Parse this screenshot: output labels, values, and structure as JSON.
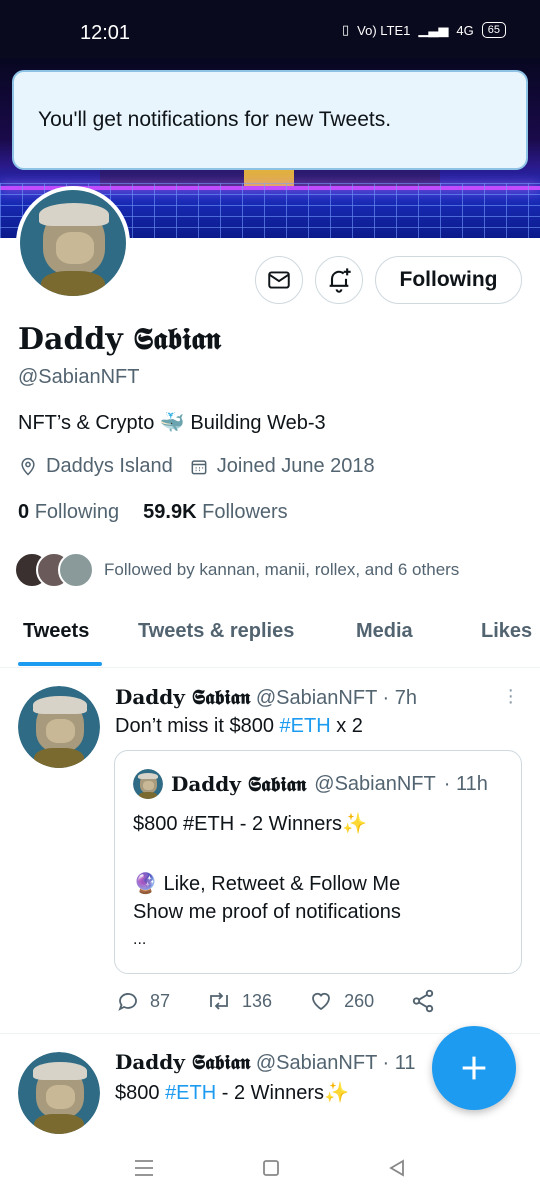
{
  "status_bar": {
    "time": "12:01",
    "network": "Vo) LTE1",
    "signal": "4G",
    "battery": "65"
  },
  "toast": {
    "message": "You'll get notifications for new Tweets."
  },
  "profile": {
    "display_name": "Daddy 𝕾𝖆𝖇𝖎𝖆𝖓",
    "handle": "@SabianNFT",
    "bio_part1": "NFT’s & Crypto",
    "bio_emoji": "🐳",
    "bio_part2": "Building Web-3",
    "location": "Daddys Island",
    "joined": "Joined June 2018",
    "following_count": "0",
    "following_label": "Following",
    "followers_count": "59.9K",
    "followers_label": "Followers",
    "followed_by": "Followed by kannan, manii, rollex, and 6 others",
    "follow_button": "Following"
  },
  "tabs": [
    {
      "label": "Tweets"
    },
    {
      "label": "Tweets & replies"
    },
    {
      "label": "Media"
    },
    {
      "label": "Likes"
    }
  ],
  "tweets": [
    {
      "name": "Daddy 𝕾𝖆𝖇𝖎𝖆𝖓",
      "handle": "@SabianNFT",
      "time": "· 7h",
      "text_before": "Don’t miss it $800 ",
      "hashtag": "#ETH",
      "text_after": " x 2",
      "quote": {
        "name": "Daddy 𝕾𝖆𝖇𝖎𝖆𝖓",
        "handle": "@SabianNFT",
        "time": "· 11h",
        "line1": "$800 #ETH - 2 Winners✨",
        "line2": "🔮 Like, Retweet & Follow Me",
        "line3": "Show me proof of notifications",
        "line4": "..."
      },
      "replies": "87",
      "retweets": "136",
      "likes": "260"
    },
    {
      "name": "Daddy 𝕾𝖆𝖇𝖎𝖆𝖓",
      "handle": "@SabianNFT",
      "time": "· 11",
      "text_before": "$800 ",
      "hashtag": "#ETH",
      "text_after": " - 2 Winners✨"
    }
  ],
  "colors": {
    "accent": "#1d9bf0",
    "secondary_text": "#536471",
    "toast_bg": "#e8f5fd"
  }
}
